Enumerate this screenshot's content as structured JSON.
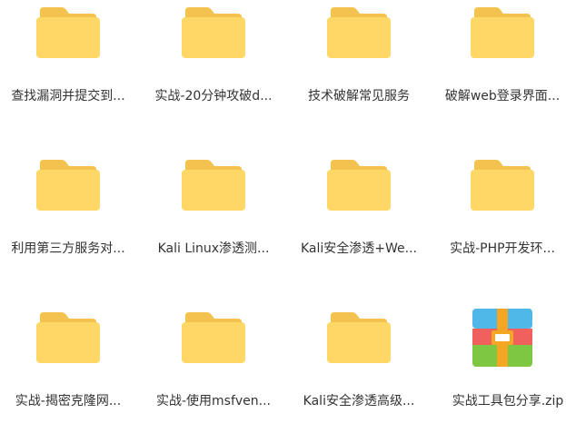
{
  "items": [
    {
      "name": "查找漏洞并提交到...",
      "type": "folder"
    },
    {
      "name": "实战-20分钟攻破d...",
      "type": "folder"
    },
    {
      "name": "技术破解常见服务",
      "type": "folder"
    },
    {
      "name": "破解web登录界面...",
      "type": "folder"
    },
    {
      "name": "利用第三方服务对...",
      "type": "folder"
    },
    {
      "name": "Kali Linux渗透测...",
      "type": "folder"
    },
    {
      "name": "Kali安全渗透+We...",
      "type": "folder"
    },
    {
      "name": "实战-PHP开发环...",
      "type": "folder"
    },
    {
      "name": "实战-揭密克隆网...",
      "type": "folder"
    },
    {
      "name": "实战-使用msfven...",
      "type": "folder"
    },
    {
      "name": "Kali安全渗透高级...",
      "type": "folder"
    },
    {
      "name": "实战工具包分享.zip",
      "type": "zip"
    }
  ],
  "colors": {
    "folder_back": "#F4C34F",
    "folder_front": "#FFD766",
    "zip_blue": "#4FB8E8",
    "zip_red": "#F0605D",
    "zip_green": "#7DC743",
    "zip_strap": "#F5A623",
    "label_text": "#333333"
  },
  "icons": {
    "folder": "folder-icon",
    "zip": "zip-archive-icon"
  }
}
